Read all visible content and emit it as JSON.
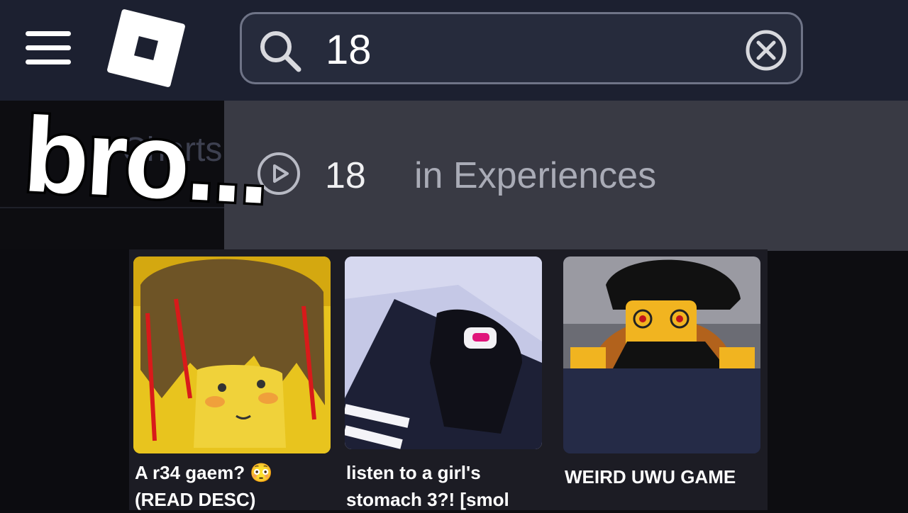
{
  "header": {
    "menu_icon": "hamburger-menu-icon",
    "logo_icon": "roblox-logo-icon",
    "search": {
      "value": "18",
      "search_icon": "search-icon",
      "clear_icon": "clear-x-icon"
    }
  },
  "nav": {
    "charts_label": "Charts"
  },
  "dropdown": {
    "suggestion": {
      "icon": "play-icon",
      "query": "18",
      "suffix": "in Experiences"
    }
  },
  "results": [
    {
      "title_line1": "A r34 gaem? 😳",
      "title_line2": "(READ DESC)"
    },
    {
      "title_line1": "listen to a girl's",
      "title_line2": "stomach 3?! [smol"
    },
    {
      "title_line1": "WEIRD UWU GAME",
      "title_line2": ""
    }
  ],
  "overlay": {
    "caption": "bro..."
  },
  "colors": {
    "topbar": "#1c2030",
    "dropdown": "#393a44",
    "results_bg": "#1c1c24",
    "card_navy": "#252b47"
  }
}
